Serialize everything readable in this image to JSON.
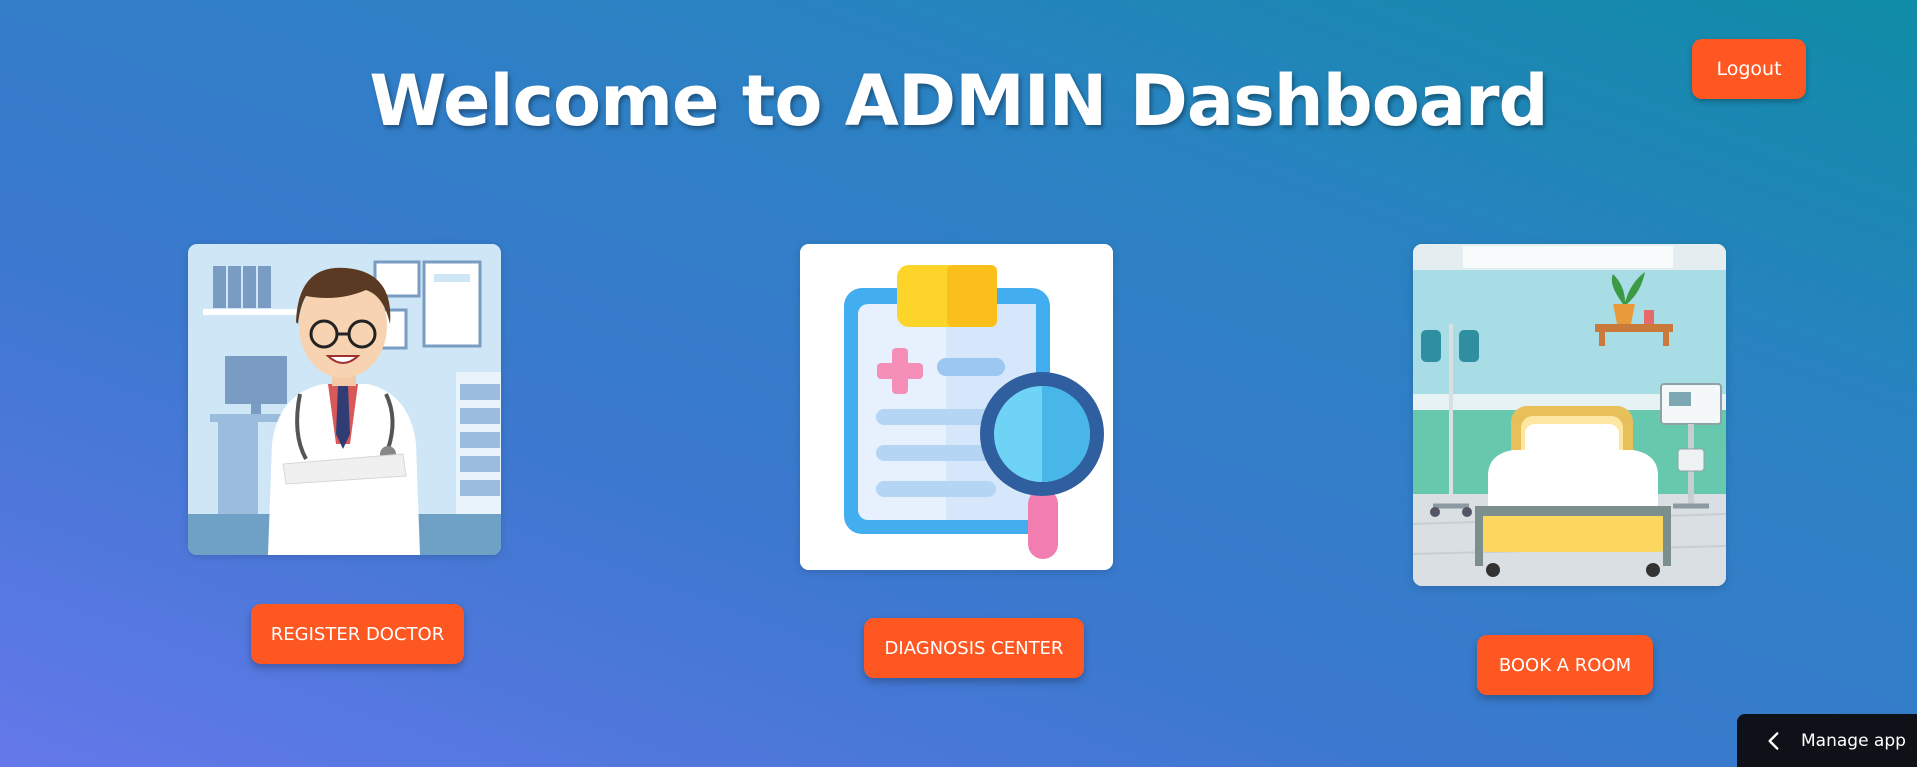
{
  "header": {
    "title": "Welcome to ADMIN Dashboard",
    "logout_label": "Logout"
  },
  "cards": [
    {
      "image_icon": "doctor-illustration",
      "button_label": "REGISTER DOCTOR"
    },
    {
      "image_icon": "clipboard-magnifier-illustration",
      "button_label": "DIAGNOSIS CENTER"
    },
    {
      "image_icon": "hospital-room-illustration",
      "button_label": "BOOK A ROOM"
    }
  ],
  "footer": {
    "manage_app_label": "Manage app",
    "manage_icon": "chevron-left-icon"
  },
  "colors": {
    "accent": "#ff5722",
    "bg_start": "#0f8ca6",
    "bg_end": "#6478ea",
    "manage_bg": "#0e1117"
  }
}
